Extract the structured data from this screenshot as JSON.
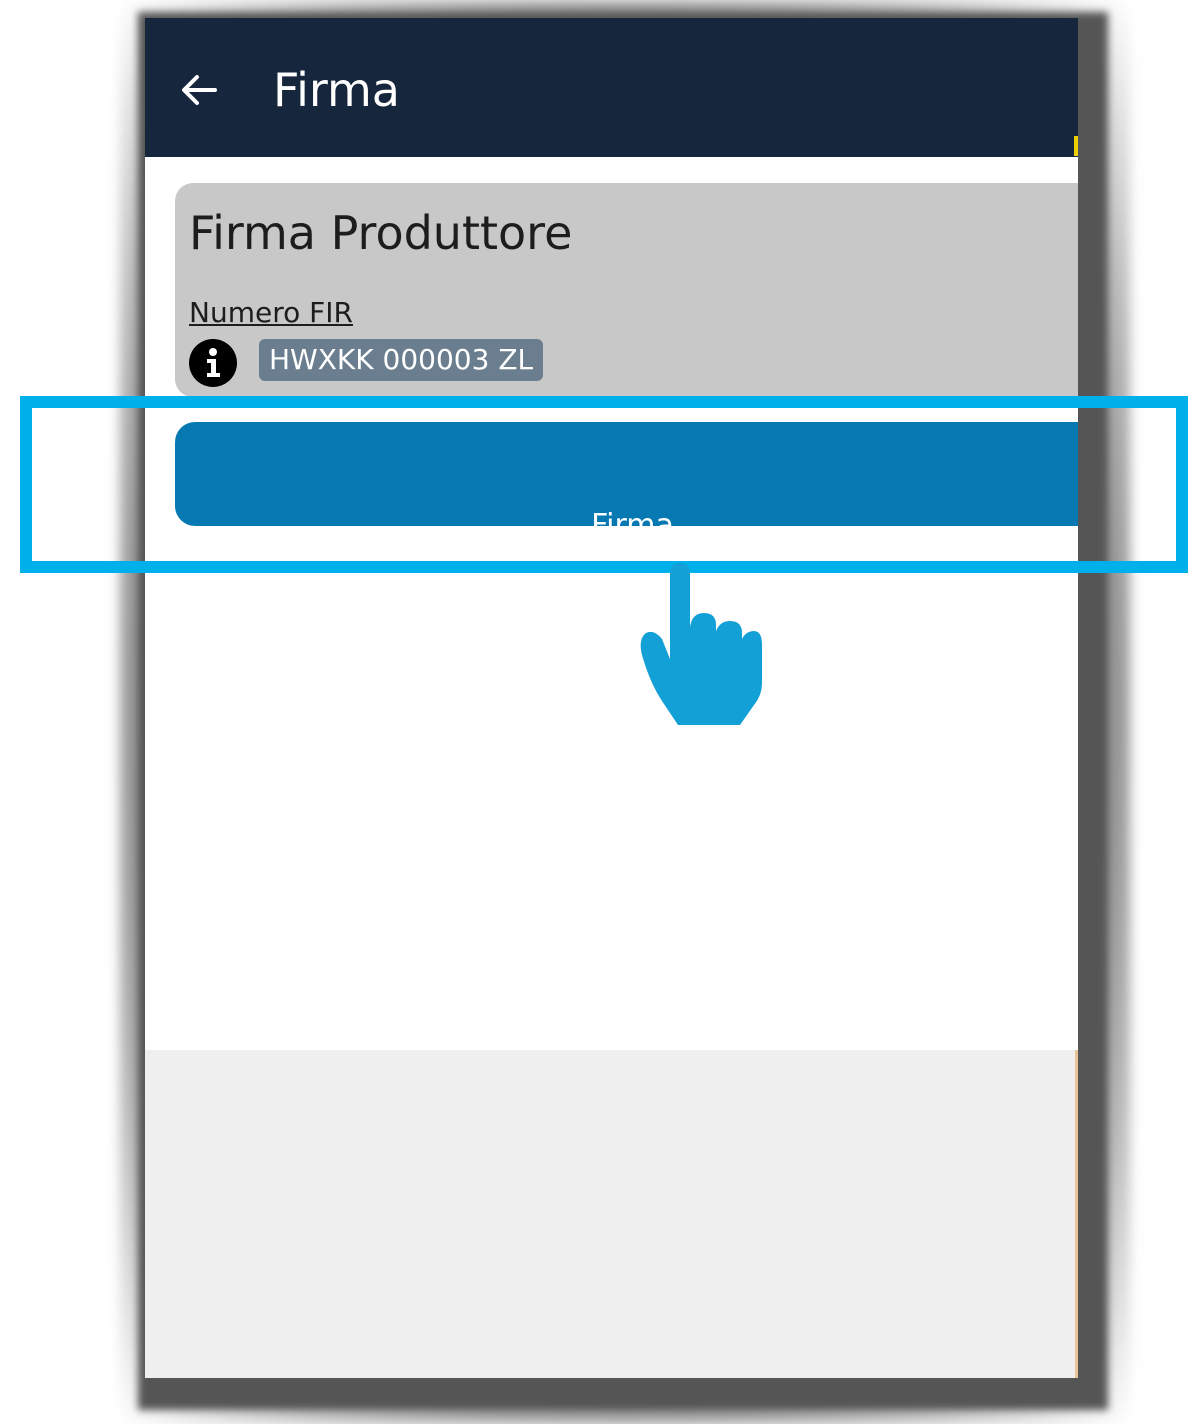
{
  "app_bar": {
    "title": "Firma",
    "back_icon": "arrow-left-icon",
    "background": "#16263c"
  },
  "card": {
    "title": "Firma Produttore",
    "field_label": "Numero FIR",
    "info_icon": "info-circle-icon",
    "fir_value": "HWXKK 000003 ZL"
  },
  "action": {
    "button_label": "Firma",
    "button_color": "#0779b2"
  },
  "overlay": {
    "highlight_color": "#00b0ea",
    "pointer_icon": "hand-pointer-icon"
  }
}
